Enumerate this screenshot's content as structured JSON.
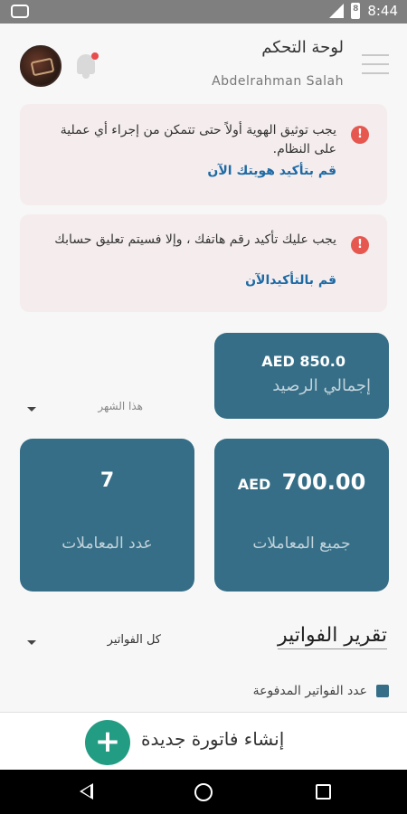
{
  "status_bar": {
    "time": "8:44",
    "battery": "8"
  },
  "header": {
    "title": "لوحة التحكم",
    "user_name": "Abdelrahman Salah"
  },
  "alerts": [
    {
      "icon": "alert-icon",
      "text": "يجب توثيق الهوية أولاً حتى تتمكن من إجراء أي عملية على النظام.",
      "link": "قم بتأكيد هويتك الآن"
    },
    {
      "icon": "alert-icon",
      "text": "يجب عليك تأكيد رقم هاتفك ، وإلا فسيتم تعليق حسابك",
      "link": "قم بالتأكيدالآن"
    }
  ],
  "balance_card": {
    "amount": "AED 850.0",
    "label": "إجمالي الرصيد"
  },
  "period_select": {
    "selected": "هذا الشهر"
  },
  "stats": {
    "count": {
      "value": "7",
      "label": "عدد المعاملات"
    },
    "total": {
      "currency": "AED",
      "value": "700.00",
      "label": "جميع المعاملات"
    }
  },
  "invoices": {
    "title": "تقرير الفواتير",
    "filter_selected": "كل الفواتير",
    "legend": "عدد الفواتير المدفوعة"
  },
  "create_invoice": {
    "label": "إنشاء فاتورة جديدة",
    "icon": "plus-icon"
  },
  "colors": {
    "card": "#356e86",
    "alert_bg": "#f5eded",
    "alert_icon": "#e5574f",
    "link": "#1e6aa5",
    "fab": "#229c82"
  }
}
